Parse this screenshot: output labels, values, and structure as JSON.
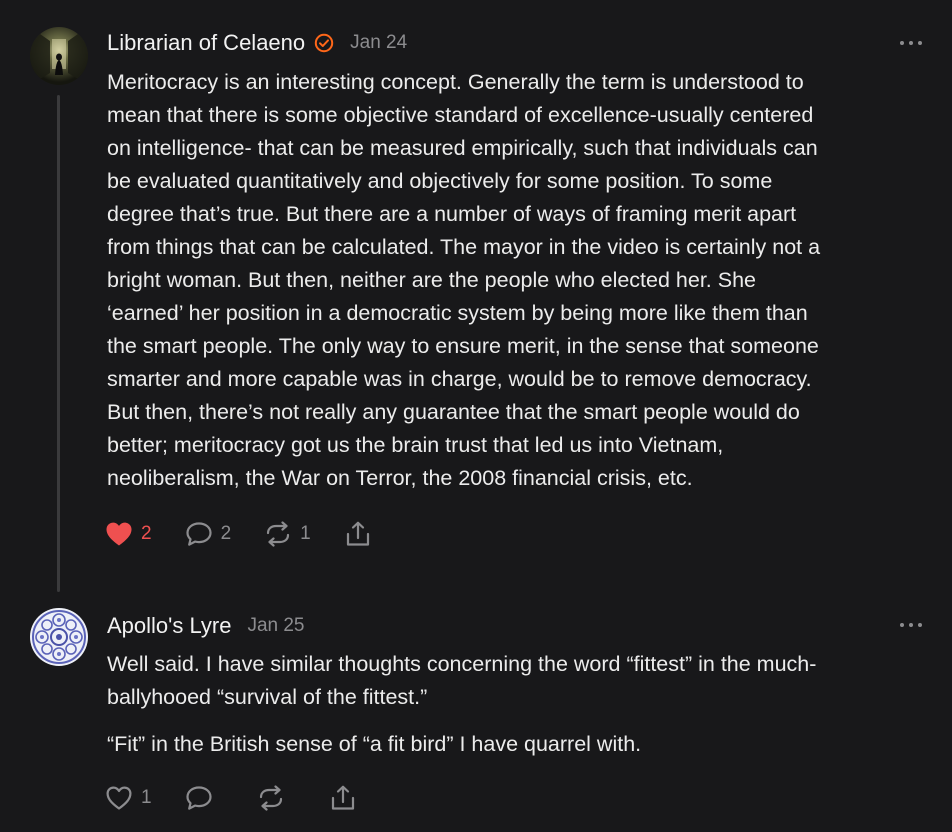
{
  "colors": {
    "background": "#18181a",
    "text": "#ececec",
    "muted": "#8c8c8f",
    "like_active": "#ef5050",
    "verified_badge": "#ff6719"
  },
  "comments": [
    {
      "author": "Librarian of Celaeno",
      "verified_icon": "verified-badge-icon",
      "date": "Jan 24",
      "lines": [
        "Meritocracy is an interesting concept. Generally the term is understood to",
        "mean that there is some objective standard of excellence-usually centered",
        "on intelligence- that can be measured empirically, such that individuals can",
        "be evaluated quantitatively and objectively for some position. To some",
        "degree that’s true. But there are a number of ways of framing merit apart",
        "from things that can be calculated. The mayor in the video is certainly not a",
        "bright woman. But then, neither are the people who elected her. She",
        "‘earned’ her position in a democratic system by being more like them than",
        "the smart people. The only way to ensure merit, in the sense that someone",
        "smarter and more capable was in charge, would be to remove democracy.",
        "But then, there’s not really any guarantee that the smart people would do",
        "better; meritocracy got us the brain trust that led us into Vietnam,",
        "neoliberalism, the War on Terror, the 2008 financial crisis, etc."
      ],
      "actions": {
        "like_icon": "heart-filled-icon",
        "likes": "2",
        "reply_icon": "speech-bubble-icon",
        "replies": "2",
        "restack_icon": "restack-arrows-icon",
        "restacks": "1",
        "share_icon": "share-icon"
      }
    },
    {
      "author": "Apollo's Lyre",
      "date": "Jan 25",
      "paragraphs": [
        [
          "Well said. I have similar thoughts concerning the word “fittest” in the much-",
          "ballyhooed “survival of the fittest.”"
        ],
        [
          "“Fit” in the British sense of “a fit bird” I have quarrel with."
        ]
      ],
      "actions": {
        "like_icon": "heart-outline-icon",
        "likes": "1",
        "reply_icon": "speech-bubble-icon",
        "restack_icon": "restack-arrows-icon",
        "share_icon": "share-icon"
      }
    }
  ]
}
